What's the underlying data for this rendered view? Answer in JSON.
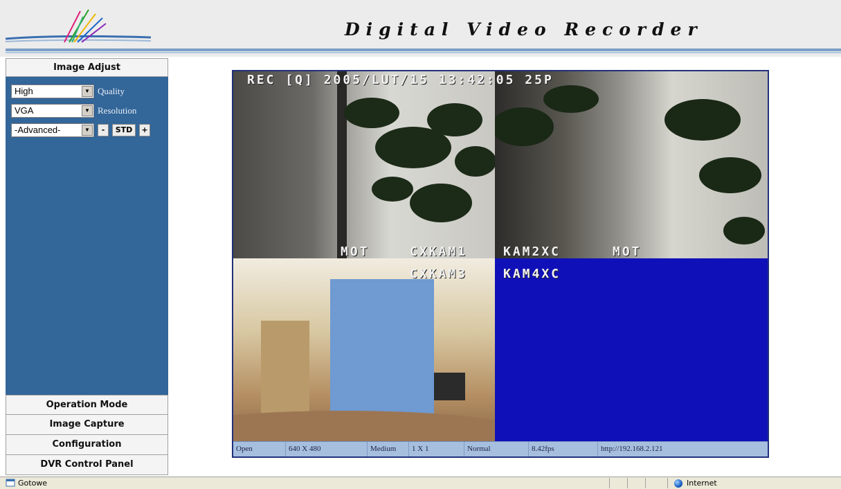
{
  "header": {
    "title": "Digital Video Recorder"
  },
  "sidebar": {
    "image_adjust_title": "Image Adjust",
    "quality": {
      "value": "High",
      "label": "Quality"
    },
    "resolution": {
      "value": "VGA",
      "label": "Resolution"
    },
    "advanced": {
      "value": "-Advanced-",
      "minus": "-",
      "std": "STD",
      "plus": "+"
    },
    "menu": [
      "Operation Mode",
      "Image Capture",
      "Configuration",
      "DVR Control Panel"
    ]
  },
  "video": {
    "osd_top": "REC [Q]  2005/LUT/15  13:42:05  25P",
    "osd_cam1_mot": "MOT",
    "osd_cam1": "CXKAM1",
    "osd_cam2": "KAM2XC",
    "osd_cam2_mot": "MOT",
    "osd_cam3": "CXKAM3",
    "osd_cam4": "KAM4XC",
    "status": [
      "Open",
      "640 X 480",
      "Medium",
      "1 X 1",
      "Normal",
      "8.42fps",
      "http://192.168.2.121"
    ]
  },
  "window_status": {
    "text": "Gotowe",
    "zone": "Internet"
  }
}
